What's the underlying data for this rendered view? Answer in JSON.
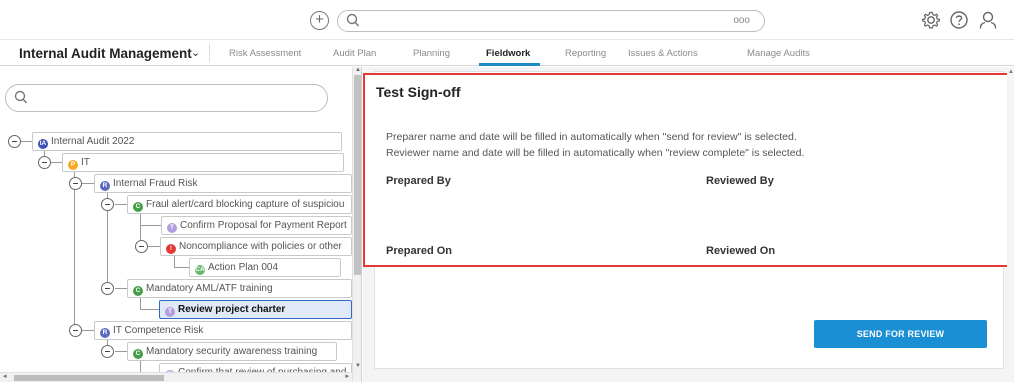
{
  "header": {
    "add_icon": "plus-circle-icon",
    "search_icon": "search-icon",
    "more_icon": "ellipsis-icon",
    "more_text": "ooo",
    "settings_icon": "gear-icon",
    "help_icon": "help-icon",
    "user_icon": "user-icon"
  },
  "nav": {
    "app_title": "Internal Audit Management",
    "app_chevron": "⌄",
    "tabs": [
      {
        "label": "Risk Assessment"
      },
      {
        "label": "Audit Plan"
      },
      {
        "label": "Planning"
      },
      {
        "label": "Fieldwork"
      },
      {
        "label": "Reporting"
      },
      {
        "label": "Issues & Actions"
      },
      {
        "label": "Manage Audits"
      }
    ],
    "active_tab": "Fieldwork"
  },
  "tree": {
    "search_placeholder": "",
    "nodes": [
      {
        "badge": "IA",
        "badge_color": "#3f51b5",
        "label": "Internal Audit 2022"
      },
      {
        "badge": "P",
        "badge_color": "#f9a825",
        "label": "IT"
      },
      {
        "badge": "R",
        "badge_color": "#5c6bc0",
        "label": "Internal Fraud Risk"
      },
      {
        "badge": "C",
        "badge_color": "#43a047",
        "label": "Fraul alert/card blocking capture of suspiciou"
      },
      {
        "badge": "T",
        "badge_color": "#b39ddb",
        "label": "Confirm Proposal for Payment Report"
      },
      {
        "badge": "!",
        "badge_color": "#e53935",
        "label": "Noncompliance with policies or other"
      },
      {
        "badge": "CA",
        "badge_color": "#66bb6a",
        "label": "Action Plan 004"
      },
      {
        "badge": "C",
        "badge_color": "#43a047",
        "label": "Mandatory AML/ATF training"
      },
      {
        "badge": "T",
        "badge_color": "#b39ddb",
        "label": "Review project charter"
      },
      {
        "badge": "R",
        "badge_color": "#5c6bc0",
        "label": "IT Competence Risk"
      },
      {
        "badge": "C",
        "badge_color": "#43a047",
        "label": "Mandatory security awareness training"
      },
      {
        "badge": "T",
        "badge_color": "#b39ddb",
        "label": "Confirm that review of purchasing and"
      }
    ],
    "selected": "Review project charter"
  },
  "signoff": {
    "title": "Test Sign-off",
    "note_preparer": "Preparer name and date will be filled in automatically when \"send for review\" is selected.",
    "note_reviewer": "Reviewer name and date will be filled in automatically when \"review complete\" is selected.",
    "prepared_by": "Prepared By",
    "reviewed_by": "Reviewed By",
    "prepared_on": "Prepared On",
    "reviewed_on": "Reviewed On",
    "send_button": "SEND FOR REVIEW"
  },
  "colors": {
    "accent": "#1e88c9",
    "button": "#1a8fd4",
    "highlight_border": "#e53935",
    "selected_bg": "#dfe9f8"
  }
}
